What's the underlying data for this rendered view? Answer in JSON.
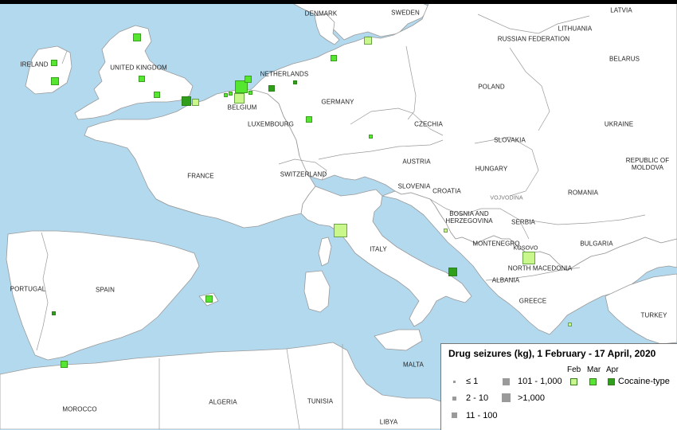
{
  "map": {
    "countries": {
      "denmark": "DENMARK",
      "sweden": "SWEDEN",
      "latvia": "LATVIA",
      "lithuania": "LITHUANIA",
      "russia": "RUSSIAN FEDERATION",
      "belarus": "BELARUS",
      "ireland": "IRELAND",
      "uk": "UNITED KINGDOM",
      "netherlands": "NETHERLANDS",
      "germany": "GERMANY",
      "poland": "POLAND",
      "belgium": "BELGIUM",
      "luxembourg": "LUXEMBOURG",
      "czechia": "CZECHIA",
      "slovakia": "SLOVAKIA",
      "ukraine": "UKRAINE",
      "france": "FRANCE",
      "austria": "AUSTRIA",
      "switzerland": "SWITZERLAND",
      "hungary": "HUNGARY",
      "moldova": "REPUBLIC OF\nMOLDOVA",
      "slovenia": "SLOVENIA",
      "croatia": "CROATIA",
      "vojvodina": "VOJVODINA",
      "romania": "ROMANIA",
      "bosnia": "BOSNIA AND\nHERZEGOVINA",
      "serbia": "SERBIA",
      "italy": "ITALY",
      "montenegro": "MONTENEGRO",
      "kosovo": "KOSOVO",
      "bulgaria": "BULGARIA",
      "north_macedonia": "NORTH MACEDONIA",
      "albania": "ALBANIA",
      "portugal": "PORTUGAL",
      "spain": "SPAIN",
      "greece": "GREECE",
      "turkey": "TURKEY",
      "malta": "MALTA",
      "algeria": "ALGERIA",
      "tunisia": "TUNISIA",
      "morocco": "MOROCCO",
      "libya": "LIBYA"
    },
    "colors": {
      "sea": "#b3d9ee",
      "land": "#ffffff",
      "border": "#9a9a9a",
      "feb": "#c9f78c",
      "mar": "#55e62f",
      "apr": "#2e9e1b"
    }
  },
  "legend": {
    "title": "Drug seizures (kg), 1 February - 17  April, 2020",
    "sizes": [
      "≤ 1",
      "2 - 10",
      "11 - 100",
      "101 - 1,000",
      ">1,000"
    ],
    "months": [
      "Feb",
      "Mar",
      "Apr"
    ],
    "drug_type": "Cocaine-type"
  },
  "seizures": [
    {
      "location": "Scotland",
      "month": "Mar",
      "size_class": "11 - 100"
    },
    {
      "location": "Northern Ireland",
      "month": "Mar",
      "size_class": "2 - 10"
    },
    {
      "location": "Ireland",
      "month": "Mar",
      "size_class": "11 - 100"
    },
    {
      "location": "England (midlands)",
      "month": "Mar",
      "size_class": "2 - 10"
    },
    {
      "location": "England (south)",
      "month": "Mar",
      "size_class": "2 - 10"
    },
    {
      "location": "Channel coast",
      "month": "Apr",
      "size_class": "11 - 100"
    },
    {
      "location": "Channel coast",
      "month": "Feb",
      "size_class": "2 - 10"
    },
    {
      "location": "Belgium coast",
      "month": "Mar",
      "size_class": "≤ 1"
    },
    {
      "location": "Belgium coast",
      "month": "Mar",
      "size_class": "≤ 1"
    },
    {
      "location": "Antwerp",
      "month": "Mar",
      "size_class": ">1,000"
    },
    {
      "location": "Antwerp",
      "month": "Feb",
      "size_class": "101 - 1,000"
    },
    {
      "location": "Rotterdam",
      "month": "Mar",
      "size_class": "11 - 100"
    },
    {
      "location": "Belgium",
      "month": "Mar",
      "size_class": "≤ 1"
    },
    {
      "location": "Netherlands",
      "month": "Apr",
      "size_class": "2 - 10"
    },
    {
      "location": "Netherlands (east)",
      "month": "Apr",
      "size_class": "≤ 1"
    },
    {
      "location": "Northern Germany",
      "month": "Mar",
      "size_class": "2 - 10"
    },
    {
      "location": "Baltic (Sweden south)",
      "month": "Feb",
      "size_class": "11 - 100"
    },
    {
      "location": "Central Germany",
      "month": "Mar",
      "size_class": "2 - 10"
    },
    {
      "location": "Eastern Germany",
      "month": "Mar",
      "size_class": "≤ 1"
    },
    {
      "location": "Livorno",
      "month": "Feb",
      "size_class": "101 - 1,000"
    },
    {
      "location": "Adriatic coast",
      "month": "Feb",
      "size_class": "≤ 1"
    },
    {
      "location": "Gioia Tauro",
      "month": "Apr",
      "size_class": "11 - 100"
    },
    {
      "location": "North Macedonia",
      "month": "Feb",
      "size_class": "101 - 1,000"
    },
    {
      "location": "Balearic Islands",
      "month": "Mar",
      "size_class": "2 - 10"
    },
    {
      "location": "Spain (south-west)",
      "month": "Apr",
      "size_class": "≤ 1"
    },
    {
      "location": "Algeciras",
      "month": "Mar",
      "size_class": "2 - 10"
    },
    {
      "location": "Greece (Aegean)",
      "month": "Feb",
      "size_class": "≤ 1"
    }
  ]
}
